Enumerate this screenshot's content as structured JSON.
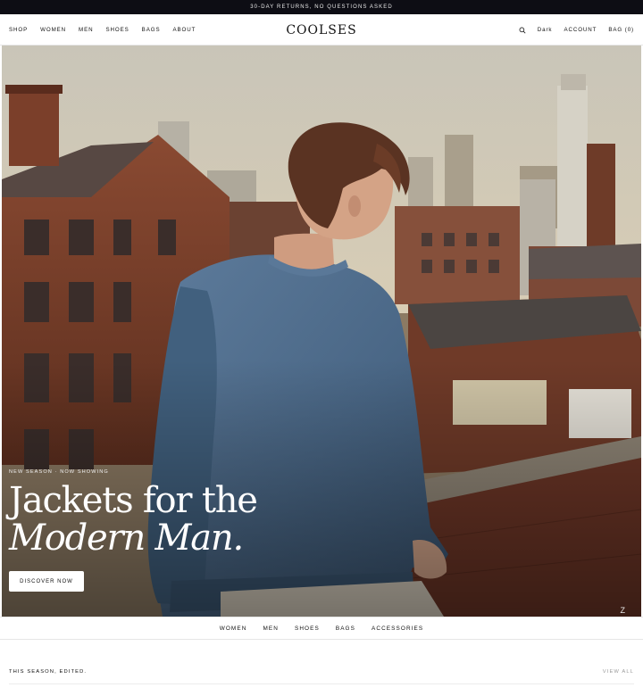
{
  "announcement": "30-DAY RETURNS, NO QUESTIONS ASKED",
  "header": {
    "nav": [
      "SHOP",
      "WOMEN",
      "MEN",
      "SHOES",
      "BAGS",
      "ABOUT"
    ],
    "logo": "COOLSES",
    "search_icon": "search-icon",
    "theme_toggle": "Dark",
    "account": "ACCOUNT",
    "bag": "BAG (0)"
  },
  "hero": {
    "eyebrow": "NEW SEASON · NOW SHOWING",
    "headline_line1": "Jackets for the",
    "headline_line2": "Modern Man.",
    "cta": "DISCOVER NOW"
  },
  "category_bar": [
    "WOMEN",
    "MEN",
    "SHOES",
    "BAGS",
    "ACCESSORIES"
  ],
  "section": {
    "title": "THIS SEASON, EDITED.",
    "view_all": "VIEW ALL"
  },
  "colors": {
    "announcement_bg": "#0d0d14",
    "sweater": "#4d6b8c",
    "brick": "#7a3e2a"
  }
}
